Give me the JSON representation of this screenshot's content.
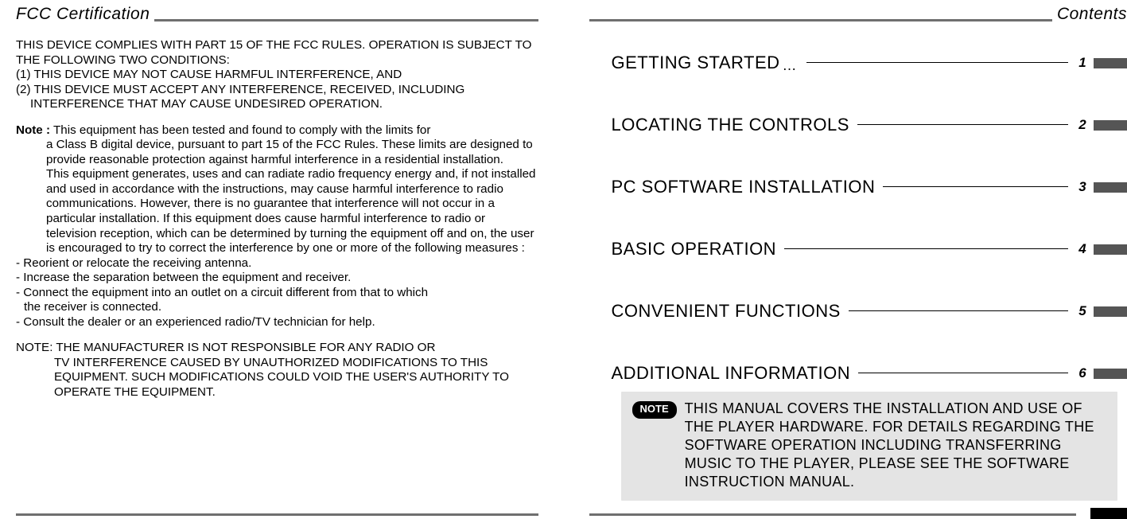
{
  "left": {
    "title": "FCC Certification",
    "intro1": "THIS DEVICE COMPLIES WITH PART 15 OF THE FCC RULES. OPERATION IS SUBJECT TO THE FOLLOWING TWO CONDITIONS:",
    "cond1": "(1) THIS DEVICE MAY NOT CAUSE HARMFUL INTERFERENCE, AND",
    "cond2a": "(2) THIS DEVICE MUST ACCEPT ANY INTERFERENCE,  RECEIVED, INCLUDING",
    "cond2b": "INTERFERENCE THAT MAY CAUSE UNDESIRED OPERATION.",
    "note_label": "Note :",
    "note_p1": "This equipment has been tested and found to comply with the limits for a Class B digital device, pursuant to part 15 of the FCC Rules. These limits are designed to provide reasonable protection against harmful interference in a residential installation.",
    "note_p2": "This equipment generates, uses and can radiate radio frequency energy and, if not installed and used in accordance with the instructions, may cause harmful interference to radio communications. However, there is no guarantee that interference will not occur in a particular installation. If this equipment does cause harmful interference  to radio or television reception, which can be determined by turning the equipment off and on, the user is encouraged to try to correct the interference by one or more of the following measures :",
    "m1": "- Reorient or relocate the receiving antenna.",
    "m2": "- Increase the separation between the equipment and receiver.",
    "m3a": "- Connect the equipment into an outlet on a circuit different from that to which",
    "m3b": "the receiver is connected.",
    "m4": "- Consult the dealer or an experienced radio/TV technician for help.",
    "final_label": "NOTE:",
    "final_body": "THE MANUFACTURER IS NOT RESPONSIBLE FOR ANY RADIO OR TV INTERFERENCE CAUSED BY UNAUTHORIZED MODIFICATIONS TO THIS EQUIPMENT. SUCH MODIFICATIONS COULD VOID THE USER'S AUTHORITY TO OPERATE THE EQUIPMENT."
  },
  "right": {
    "title": "Contents",
    "toc": [
      {
        "label": "GETTING STARTED",
        "page": "1",
        "dots": true
      },
      {
        "label": "LOCATING THE CONTROLS",
        "page": "2",
        "dots": false
      },
      {
        "label": "PC SOFTWARE INSTALLATION",
        "page": "3",
        "dots": false
      },
      {
        "label": "BASIC OPERATION",
        "page": "4",
        "dots": false
      },
      {
        "label": "CONVENIENT FUNCTIONS",
        "page": "5",
        "dots": false
      },
      {
        "label": "ADDITIONAL INFORMATION",
        "page": "6",
        "dots": false
      }
    ],
    "note_pill": "NOTE",
    "note_text": "THIS MANUAL COVERS THE INSTALLATION AND USE OF THE PLAYER HARDWARE. FOR DETAILS REGARDING THE SOFTWARE OPERATION INCLUDING TRANSFERRING MUSIC TO THE PLAYER, PLEASE SEE THE SOFTWARE INSTRUCTION MANUAL."
  }
}
